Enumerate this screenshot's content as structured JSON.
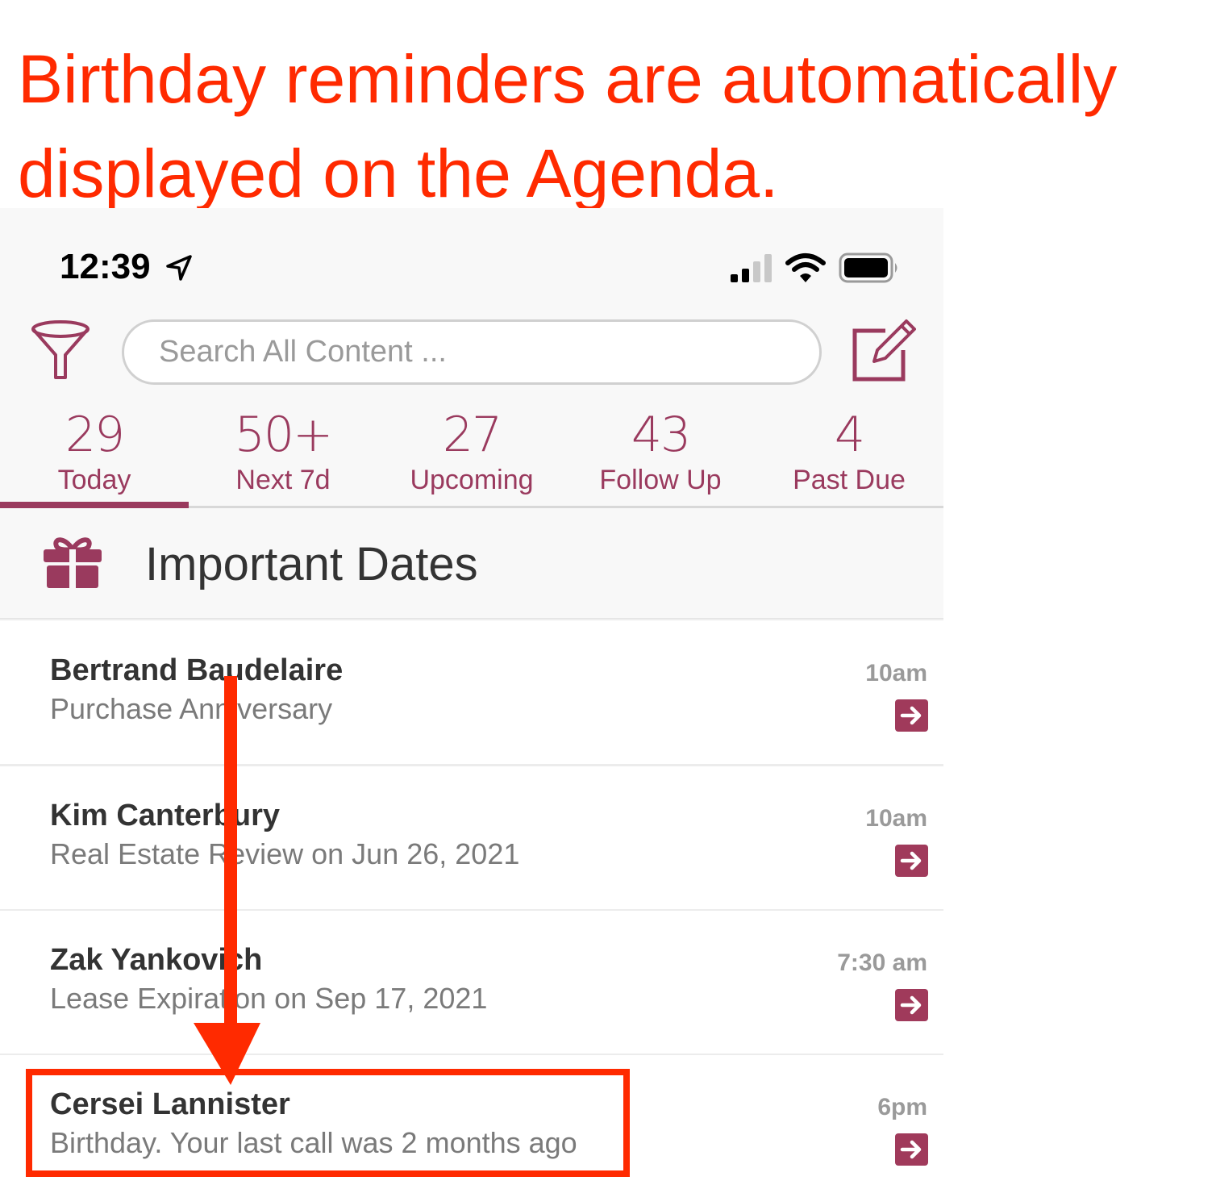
{
  "caption": {
    "line1": "Birthday reminders are automatically",
    "line2": "displayed on the Agenda."
  },
  "status_bar": {
    "time": "12:39",
    "icons": [
      "location-arrow-icon",
      "cellular-signal-icon",
      "wifi-icon",
      "battery-icon"
    ]
  },
  "header": {
    "filter_icon": "funnel-icon",
    "search_placeholder": "Search All Content ...",
    "compose_icon": "compose-icon"
  },
  "tabs": [
    {
      "count": "29",
      "label": "Today",
      "active": true
    },
    {
      "count": "50+",
      "label": "Next 7d",
      "active": false
    },
    {
      "count": "27",
      "label": "Upcoming",
      "active": false
    },
    {
      "count": "43",
      "label": "Follow Up",
      "active": false
    },
    {
      "count": "4",
      "label": "Past Due",
      "active": false
    }
  ],
  "section": {
    "icon": "gift-icon",
    "title": "Important Dates"
  },
  "items": [
    {
      "name": "Bertrand Baudelaire",
      "subtitle": "Purchase Anniversary",
      "time": "10am"
    },
    {
      "name": "Kim Canterbury",
      "subtitle": "Real Estate Review on Jun 26, 2021",
      "time": "10am"
    },
    {
      "name": "Zak Yankovich",
      "subtitle": "Lease Expiration on Sep 17, 2021",
      "time": "7:30 am"
    },
    {
      "name": "Cersei Lannister",
      "subtitle": "Birthday. Your last call was 2 months ago",
      "time": "6pm"
    }
  ],
  "colors": {
    "accent": "#9a3a5e",
    "annotation": "#ff2a00",
    "go_button": "#a03a5b"
  }
}
